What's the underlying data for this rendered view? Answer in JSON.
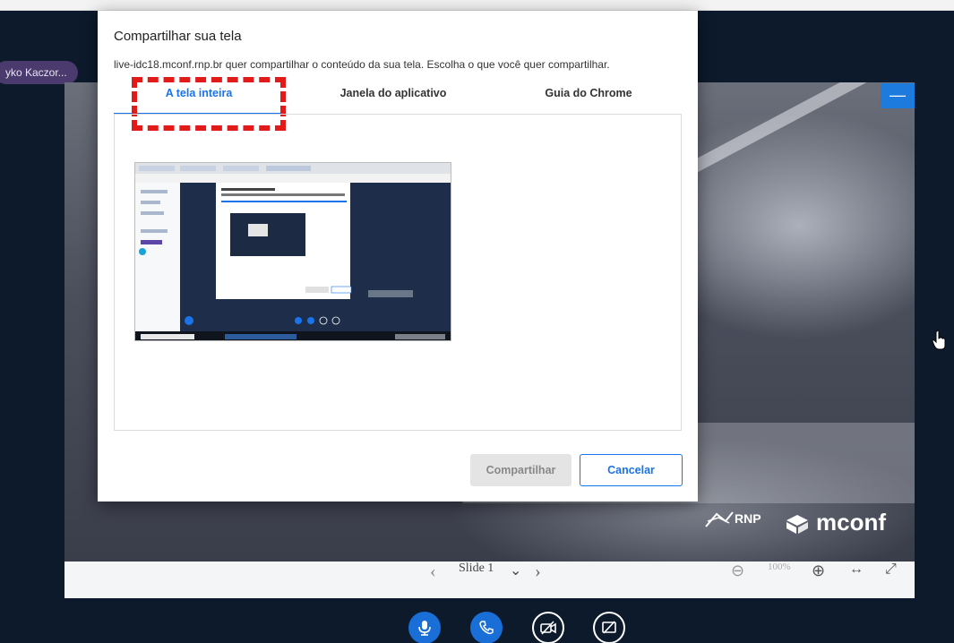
{
  "presenter": {
    "name": "yko Kaczor..."
  },
  "dialog": {
    "title": "Compartilhar sua tela",
    "description": "live-idc18.mconf.rnp.br quer compartilhar o conteúdo da sua tela. Escolha o que você quer compartilhar.",
    "tabs": [
      {
        "label": "A tela inteira",
        "active": true
      },
      {
        "label": "Janela do aplicativo",
        "active": false
      },
      {
        "label": "Guia do Chrome",
        "active": false
      }
    ],
    "buttons": {
      "share": "Compartilhar",
      "cancel": "Cancelar"
    }
  },
  "presentation": {
    "brand_rnp": "RNP",
    "brand_mconf": "mconf",
    "minimize_label": "—"
  },
  "slide_toolbar": {
    "prev": "‹",
    "slide_label": "Slide 1",
    "dropdown": "⌄",
    "next": "›",
    "zoom_out": "⊖",
    "zoom_level": "100%",
    "zoom_in": "⊕",
    "fit_width": "↔",
    "fullscreen": "⤢"
  },
  "colors": {
    "accent": "#1a73e8",
    "action_blue": "#1a6ed8",
    "highlight": "#e11a1a",
    "background": "#0c1a2c"
  },
  "icons": [
    "microphone-icon",
    "phone-icon",
    "camera-off-icon",
    "screen-share-icon",
    "hand-cursor-icon"
  ]
}
